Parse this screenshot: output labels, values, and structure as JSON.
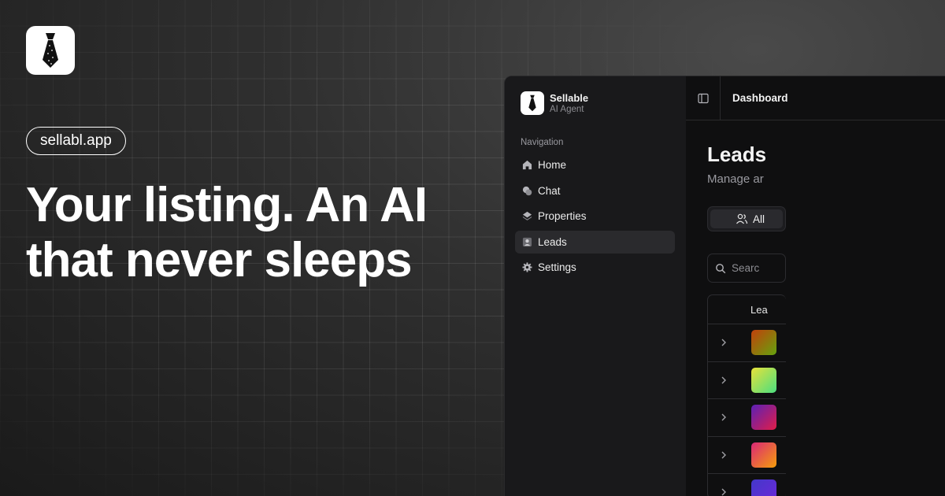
{
  "hero": {
    "domain_pill": "sellabl.app",
    "headline": "Your listing. An AI that never sleeps"
  },
  "app": {
    "brand": {
      "name": "Sellable",
      "subtitle": "AI Agent"
    },
    "nav_title": "Navigation",
    "nav_items": [
      {
        "label": "Home",
        "icon": "home-icon"
      },
      {
        "label": "Chat",
        "icon": "chat-icon"
      },
      {
        "label": "Properties",
        "icon": "properties-icon"
      },
      {
        "label": "Leads",
        "icon": "user-icon",
        "active": true
      },
      {
        "label": "Settings",
        "icon": "gear-icon"
      }
    ],
    "breadcrumb": "Dashboard",
    "page_title": "Leads",
    "page_subtitle": "Manage ar",
    "filter_tab": "All",
    "search_placeholder": "Searc",
    "table_header": "Lea"
  },
  "colors": {
    "avatar_gradients": [
      [
        "#c2410c",
        "#65a30d"
      ],
      [
        "#e8e23a",
        "#4ade80"
      ],
      [
        "#5b21b6",
        "#e11d48"
      ],
      [
        "#db2777",
        "#f59e0b"
      ],
      [
        "#4338ca",
        "#6d28d9"
      ]
    ]
  }
}
